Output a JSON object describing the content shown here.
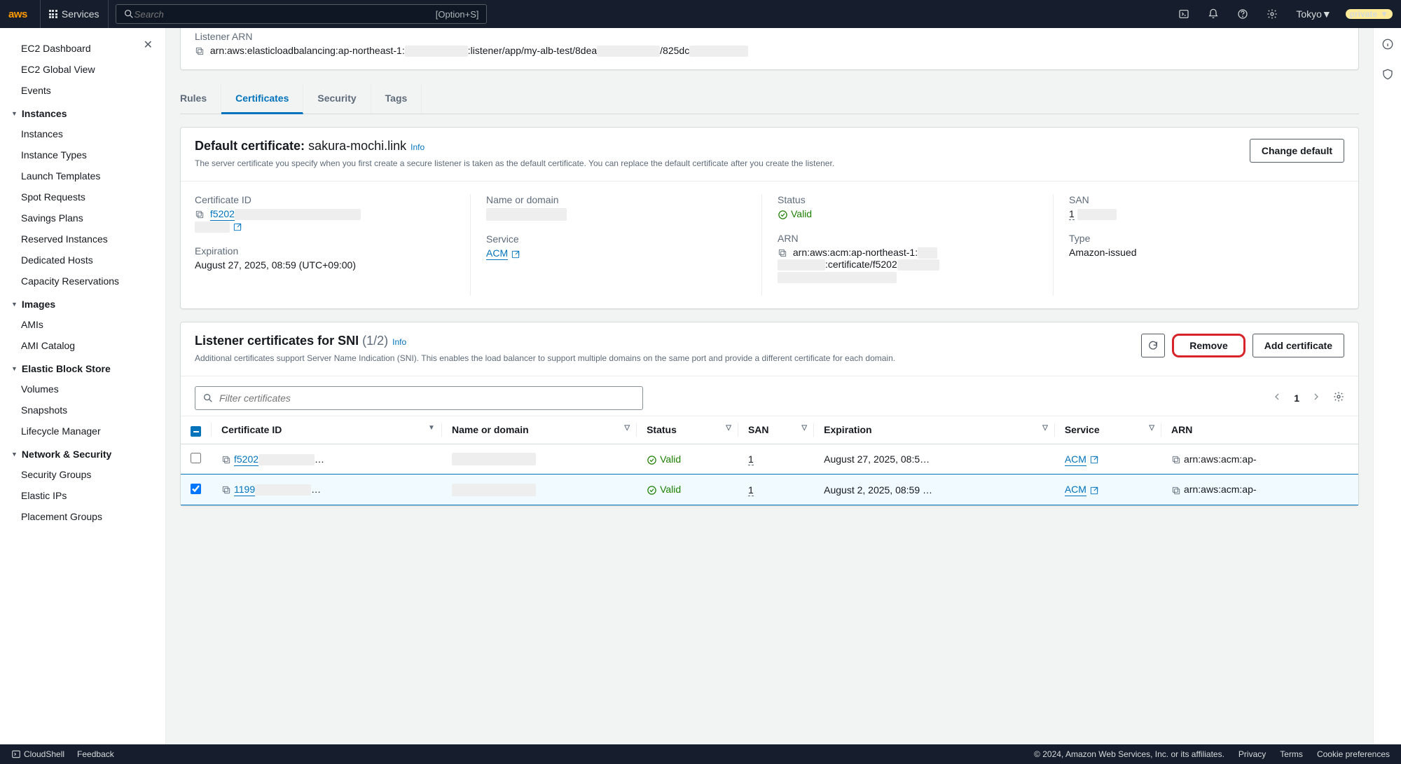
{
  "topnav": {
    "services": "Services",
    "search_placeholder": "Search",
    "search_kbd": "[Option+S]",
    "region": "Tokyo",
    "private": "private"
  },
  "sidebar": {
    "top": [
      "EC2 Dashboard",
      "EC2 Global View",
      "Events"
    ],
    "sections": [
      {
        "title": "Instances",
        "items": [
          "Instances",
          "Instance Types",
          "Launch Templates",
          "Spot Requests",
          "Savings Plans",
          "Reserved Instances",
          "Dedicated Hosts",
          "Capacity Reservations"
        ]
      },
      {
        "title": "Images",
        "items": [
          "AMIs",
          "AMI Catalog"
        ]
      },
      {
        "title": "Elastic Block Store",
        "items": [
          "Volumes",
          "Snapshots",
          "Lifecycle Manager"
        ]
      },
      {
        "title": "Network & Security",
        "items": [
          "Security Groups",
          "Elastic IPs",
          "Placement Groups"
        ]
      }
    ]
  },
  "listener": {
    "arn_label": "Listener ARN",
    "arn_p1": "arn:aws:elasticloadbalancing:ap-northeast-1:",
    "arn_p2": ":listener/app/my-alb-test/8dea",
    "arn_p3": "/825dc"
  },
  "tabs": [
    "Rules",
    "Certificates",
    "Security",
    "Tags"
  ],
  "defaultcert": {
    "title": "Default certificate:",
    "domain": "sakura-mochi.link",
    "info": "Info",
    "change": "Change default",
    "sub": "The server certificate you specify when you first create a secure listener is taken as the default certificate. You can replace the default certificate after you create the listener.",
    "cert_id_label": "Certificate ID",
    "cert_id": "f5202",
    "expiration_label": "Expiration",
    "expiration": "August 27, 2025, 08:59 (UTC+09:00)",
    "name_label": "Name or domain",
    "service_label": "Service",
    "service": "ACM",
    "status_label": "Status",
    "status": "Valid",
    "arn_label": "ARN",
    "arn_p1": "arn:aws:acm:ap-northeast-1:",
    "arn_p2": ":certificate/f5202",
    "san_label": "SAN",
    "san": "1",
    "type_label": "Type",
    "type": "Amazon-issued"
  },
  "sni": {
    "title": "Listener certificates for SNI",
    "count": "(1/2)",
    "info": "Info",
    "sub": "Additional certificates support Server Name Indication (SNI). This enables the load balancer to support multiple domains on the same port and provide a different certificate for each domain.",
    "remove": "Remove",
    "add": "Add certificate",
    "filter_placeholder": "Filter certificates",
    "page": "1",
    "cols": [
      "Certificate ID",
      "Name or domain",
      "Status",
      "SAN",
      "Expiration",
      "Service",
      "ARN"
    ],
    "rows": [
      {
        "selected": false,
        "id": "f5202",
        "status": "Valid",
        "san": "1",
        "exp": "August 27, 2025, 08:5…",
        "service": "ACM",
        "arn": "arn:aws:acm:ap-"
      },
      {
        "selected": true,
        "id": "1199",
        "status": "Valid",
        "san": "1",
        "exp": "August 2, 2025, 08:59 …",
        "service": "ACM",
        "arn": "arn:aws:acm:ap-"
      }
    ]
  },
  "footer": {
    "cloudshell": "CloudShell",
    "feedback": "Feedback",
    "copyright": "© 2024, Amazon Web Services, Inc. or its affiliates.",
    "links": [
      "Privacy",
      "Terms",
      "Cookie preferences"
    ]
  }
}
